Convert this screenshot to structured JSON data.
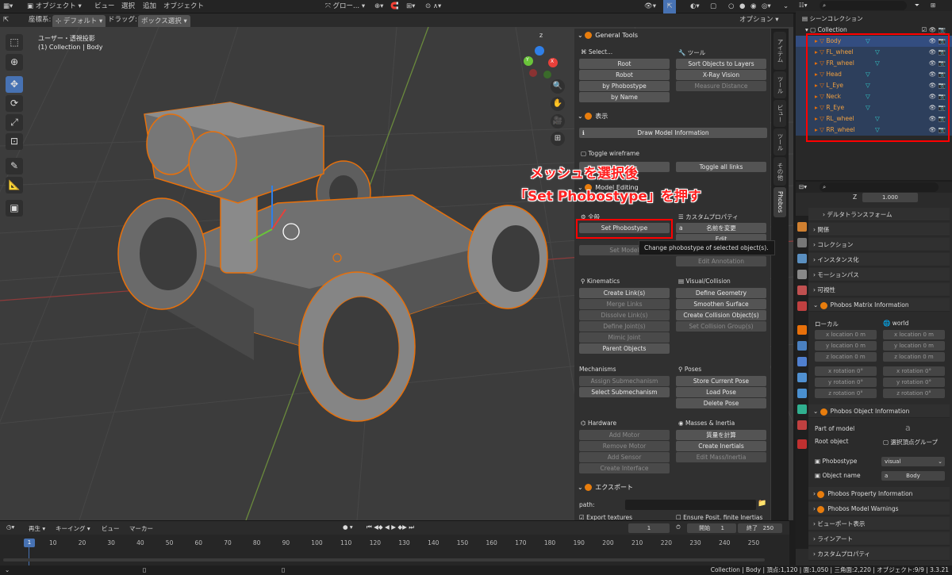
{
  "topbar": {
    "mode": "オブジェクト",
    "view": "ビュー",
    "select": "選択",
    "add": "追加",
    "object": "オブジェクト",
    "global": "グロー...",
    "options": "オプション"
  },
  "hdr2": {
    "coord_label": "座標系:",
    "coord_value": "デフォルト",
    "drag_label": "ドラッグ:",
    "drag_value": "ボックス選択"
  },
  "viewport": {
    "view_name": "ユーザー・透視投影",
    "collection": "(1) Collection | Body",
    "gizmo": {
      "x": "X",
      "y": "Y",
      "z": "Z"
    }
  },
  "npanel": {
    "general_tools": "General Tools",
    "select": "Select...",
    "tool": "ツール",
    "root": "Root",
    "sort": "Sort Objects to Layers",
    "robot": "Robot",
    "xray": "X-Ray Vision",
    "by_phobostype": "by Phobostype",
    "measure": "Measure Distance",
    "by_name": "by Name",
    "display": "表示",
    "draw_info": "Draw Model Information",
    "toggle_wire": "Toggle wireframe",
    "toggle_links": "Toggle all links",
    "model_editing": "Model Editing",
    "general": "全般",
    "custom_props": "カスタムプロパティ",
    "set_phobostype": "Set Phobostype",
    "rename": "名前を変更",
    "set_model": "Set Model",
    "edit": "Edit",
    "edit_annotation": "Edit Annotation",
    "kinematics": "Kinematics",
    "visual_collision": "Visual/Collision",
    "create_links": "Create Link(s)",
    "define_geometry": "Define Geometry",
    "merge_links": "Merge Links",
    "smoothen": "Smoothen Surface",
    "dissolve": "Dissolve Link(s)",
    "create_collision": "Create Collision Object(s)",
    "define_joints": "Define Joint(s)",
    "set_collision_group": "Set Collision Group(s)",
    "mimic": "Mimic Joint",
    "parent_objects": "Parent Objects",
    "mechanisms": "Mechanisms",
    "poses": "Poses",
    "assign_sub": "Assign Submechanism",
    "store_pose": "Store Current Pose",
    "select_sub": "Select Submechanism",
    "load_pose": "Load Pose",
    "delete_pose": "Delete Pose",
    "hardware": "Hardware",
    "masses": "Masses & Inertia",
    "add_motor": "Add Motor",
    "calc_mass": "質量を計算",
    "remove_motor": "Remove Motor",
    "create_inertials": "Create Inertials",
    "add_sensor": "Add Sensor",
    "edit_mass": "Edit Mass/Inertia",
    "create_interface": "Create Interface",
    "export": "エクスポート",
    "path": "path:",
    "export_textures": "Export textures",
    "ensure": "Ensure Posit. finite Inertias"
  },
  "tabs": [
    "アイテム",
    "ツール",
    "ビュー",
    "ツール",
    "その他",
    "Phobos"
  ],
  "tooltip": "Change phobostype of selected object(s).",
  "annotation": {
    "line1": "メッシュを選択後",
    "line2": "「Set Phobostype」を押す"
  },
  "outliner": {
    "scene_collection": "シーンコレクション",
    "collection": "Collection",
    "items": [
      "Body",
      "FL_wheel",
      "FR_wheel",
      "Head",
      "L_Eye",
      "Neck",
      "R_Eye",
      "RL_wheel",
      "RR_wheel"
    ]
  },
  "props": {
    "z_label": "Z",
    "z_value": "1.000",
    "delta": "デルタトランスフォーム",
    "relations": "関係",
    "collections": "コレクション",
    "instancing": "インスタンス化",
    "motion_paths": "モーションパス",
    "visibility": "可視性",
    "matrix_info": "Phobos Matrix Information",
    "local": "ローカル",
    "world": "world",
    "xl": "x location",
    "yl": "y location",
    "zl": "z location",
    "loc_val": "0 m",
    "xr": "x rotation",
    "yr": "y rotation",
    "zr": "z rotation",
    "rot_val": "0°",
    "object_info": "Phobos Object Information",
    "part_of_model": "Part of model",
    "root_object": "Root object",
    "root_value": "選択頂点グループ",
    "phobostype": "Phobostype",
    "phobostype_value": "visual",
    "object_name": "Object name",
    "object_name_value": "Body",
    "property_info": "Phobos Property Information",
    "model_warnings": "Phobos Model Warnings",
    "viewport_display": "ビューポート表示",
    "line_art": "ラインアート",
    "custom_props": "カスタムプロパティ"
  },
  "timeline": {
    "playback": "再生",
    "keying": "キーイング",
    "view": "ビュー",
    "marker": "マーカー",
    "current_frame": "1",
    "start_label": "開始",
    "start": "1",
    "end_label": "終了",
    "end": "250",
    "ticks": [
      "1",
      "10",
      "20",
      "30",
      "40",
      "50",
      "60",
      "70",
      "80",
      "90",
      "100",
      "110",
      "120",
      "130",
      "140",
      "150",
      "160",
      "170",
      "180",
      "190",
      "200",
      "210",
      "220",
      "230",
      "240",
      "250"
    ]
  },
  "status": "Collection | Body | 頂点:1,120 | 面:1,050 | 三角面:2,220 | オブジェクト:9/9 | 3.3.21"
}
